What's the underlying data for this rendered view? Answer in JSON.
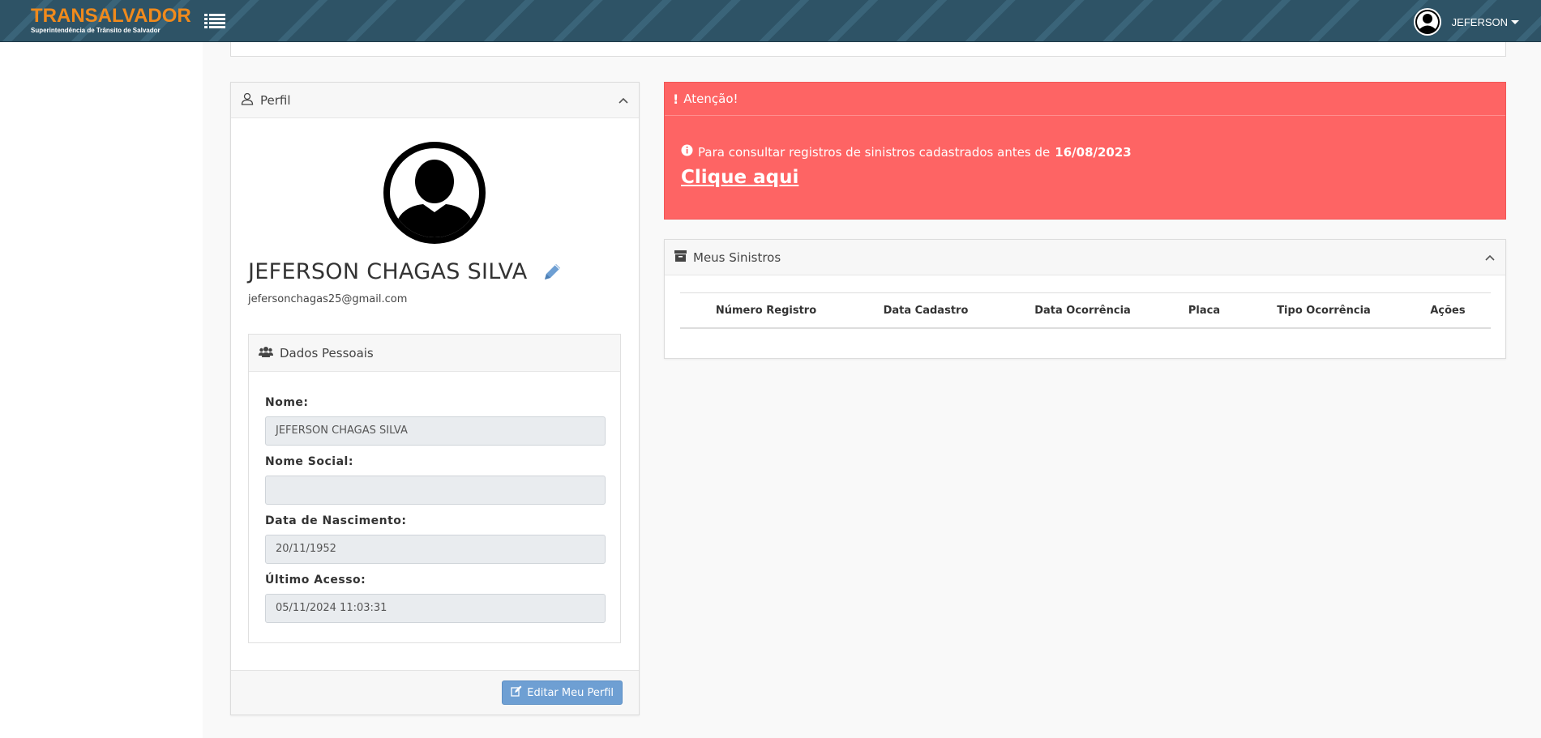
{
  "navbar": {
    "brand_title": "TRANSALVADOR",
    "brand_subtitle": "Superintendência de Trânsito de Salvador",
    "menu_icon": "list-icon",
    "user_name": "JEFERSON",
    "user_icon": "user-circle-icon"
  },
  "profile": {
    "header": "Perfil",
    "header_icon": "user-outline-icon",
    "name": "JEFERSON CHAGAS SILVA",
    "email": "jefersonchagas25@gmail.com",
    "dados": {
      "header": "Dados Pessoais",
      "header_icon": "users-icon",
      "fields": [
        {
          "label": "Nome:",
          "value": "JEFERSON CHAGAS SILVA"
        },
        {
          "label": "Nome Social:",
          "value": ""
        },
        {
          "label": "Data de Nascimento:",
          "value": "20/11/1952"
        },
        {
          "label": "Último Acesso:",
          "value": "05/11/2024 11:03:31"
        }
      ]
    },
    "edit_button": "Editar Meu Perfil"
  },
  "alert": {
    "header": "Atenção!",
    "message": "Para consultar registros de sinistros cadastrados antes de",
    "date": "16/08/2023",
    "link": "Clique aqui"
  },
  "sinistros": {
    "header": "Meus Sinistros",
    "header_icon": "archive-icon",
    "columns": [
      "Número Registro",
      "Data Cadastro",
      "Data Ocorrência",
      "Placa",
      "Tipo Ocorrência",
      "Ações"
    ]
  },
  "colors": {
    "navbar": "#2e5366",
    "brand": "#f08a1c",
    "alert": "#fe6464",
    "button": "#6e9fd3"
  }
}
